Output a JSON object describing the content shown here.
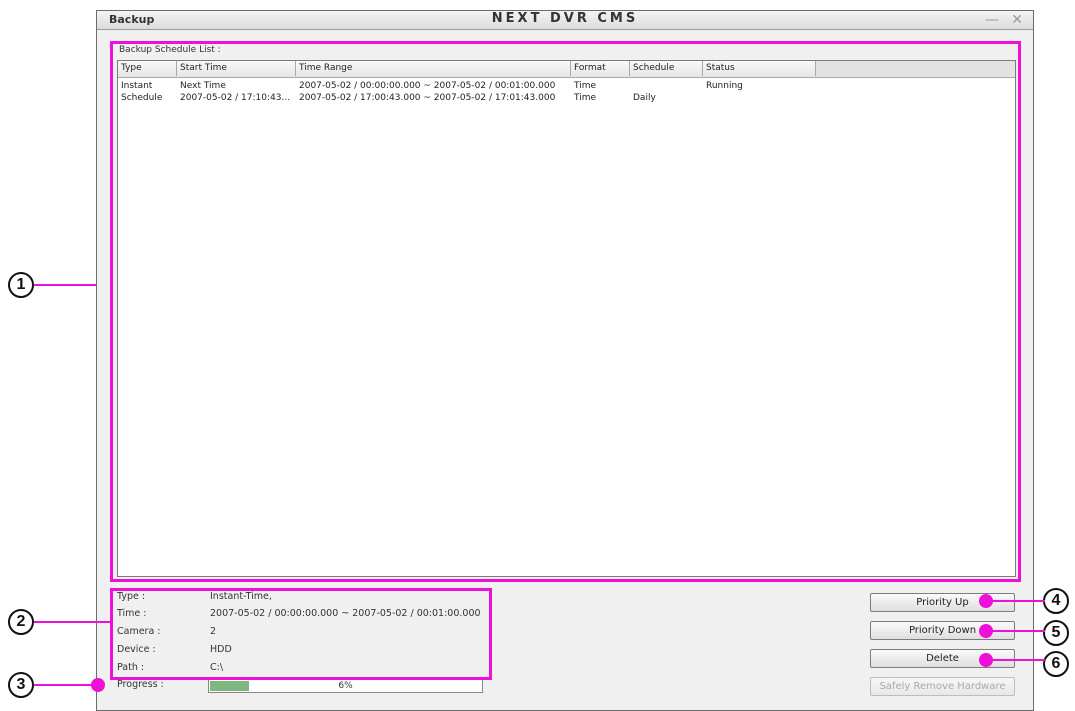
{
  "window": {
    "title_left": "Backup",
    "title_center": "NEXT DVR CMS",
    "minimize_glyph": "—",
    "close_glyph": "✕"
  },
  "schedule": {
    "label": "Backup Schedule List :",
    "columns": [
      "Type",
      "Start Time",
      "Time Range",
      "Format",
      "Schedule",
      "Status"
    ],
    "rows": [
      [
        "Instant",
        "Next Time",
        "2007-05-02 / 00:00:00.000 ~ 2007-05-02 / 00:01:00.000",
        "Time",
        "",
        "Running"
      ],
      [
        "Schedule",
        "2007-05-02 / 17:10:43...",
        "2007-05-02 / 17:00:43.000 ~ 2007-05-02 / 17:01:43.000",
        "Time",
        "Daily",
        ""
      ]
    ]
  },
  "details": {
    "type_label": "Type :",
    "type_value": "Instant-Time,",
    "time_label": "Time :",
    "time_value": "2007-05-02 / 00:00:00.000 ~ 2007-05-02 / 00:01:00.000",
    "camera_label": "Camera :",
    "camera_value": "2",
    "device_label": "Device :",
    "device_value": "HDD",
    "path_label": "Path :",
    "path_value": "C:\\",
    "progress_label": "Progress :",
    "progress_text": "6%",
    "progress_fraction": 0.06
  },
  "buttons": {
    "priority_up": "Priority Up",
    "priority_down": "Priority Down",
    "delete": "Delete",
    "safely_remove": "Safely Remove Hardware"
  },
  "callouts": [
    "1",
    "2",
    "3",
    "4",
    "5",
    "6"
  ],
  "colors": {
    "annotation": "#ee10d8",
    "progress": "#7fb87f"
  }
}
